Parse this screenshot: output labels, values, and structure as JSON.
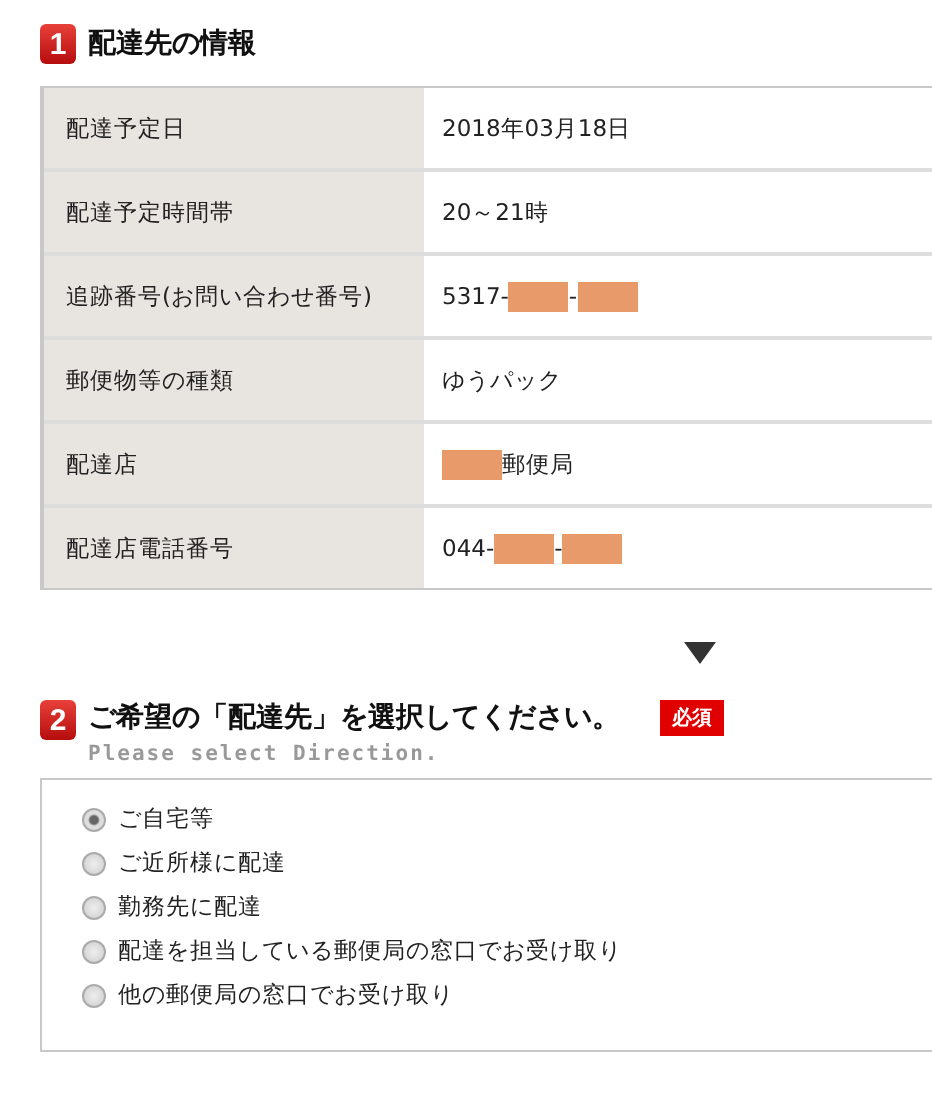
{
  "section1": {
    "number": "1",
    "title": "配達先の情報",
    "rows": [
      {
        "label": "配達予定日",
        "value": [
          {
            "kind": "text",
            "text": "2018年03月18日"
          }
        ]
      },
      {
        "label": "配達予定時間帯",
        "value": [
          {
            "kind": "text",
            "text": "20～21時"
          }
        ]
      },
      {
        "label": "追跡番号(お問い合わせ番号)",
        "value": [
          {
            "kind": "text",
            "text": "5317-"
          },
          {
            "kind": "redaction"
          },
          {
            "kind": "text",
            "text": "-"
          },
          {
            "kind": "redaction"
          }
        ]
      },
      {
        "label": "郵便物等の種類",
        "value": [
          {
            "kind": "text",
            "text": "ゆうパック"
          }
        ]
      },
      {
        "label": "配達店",
        "value": [
          {
            "kind": "redaction"
          },
          {
            "kind": "text",
            "text": "郵便局"
          }
        ]
      },
      {
        "label": "配達店電話番号",
        "value": [
          {
            "kind": "text",
            "text": "044-"
          },
          {
            "kind": "redaction"
          },
          {
            "kind": "text",
            "text": "-"
          },
          {
            "kind": "redaction"
          }
        ]
      }
    ]
  },
  "section2": {
    "number": "2",
    "title": "ご希望の「配達先」を選択してください。",
    "badge": "必須",
    "subtitle": "Please select Direction.",
    "options": [
      {
        "label": "ご自宅等",
        "selected": true
      },
      {
        "label": "ご近所様に配達",
        "selected": false
      },
      {
        "label": "勤務先に配達",
        "selected": false
      },
      {
        "label": "配達を担当している郵便局の窓口でお受け取り",
        "selected": false
      },
      {
        "label": "他の郵便局の窓口でお受け取り",
        "selected": false
      }
    ]
  }
}
